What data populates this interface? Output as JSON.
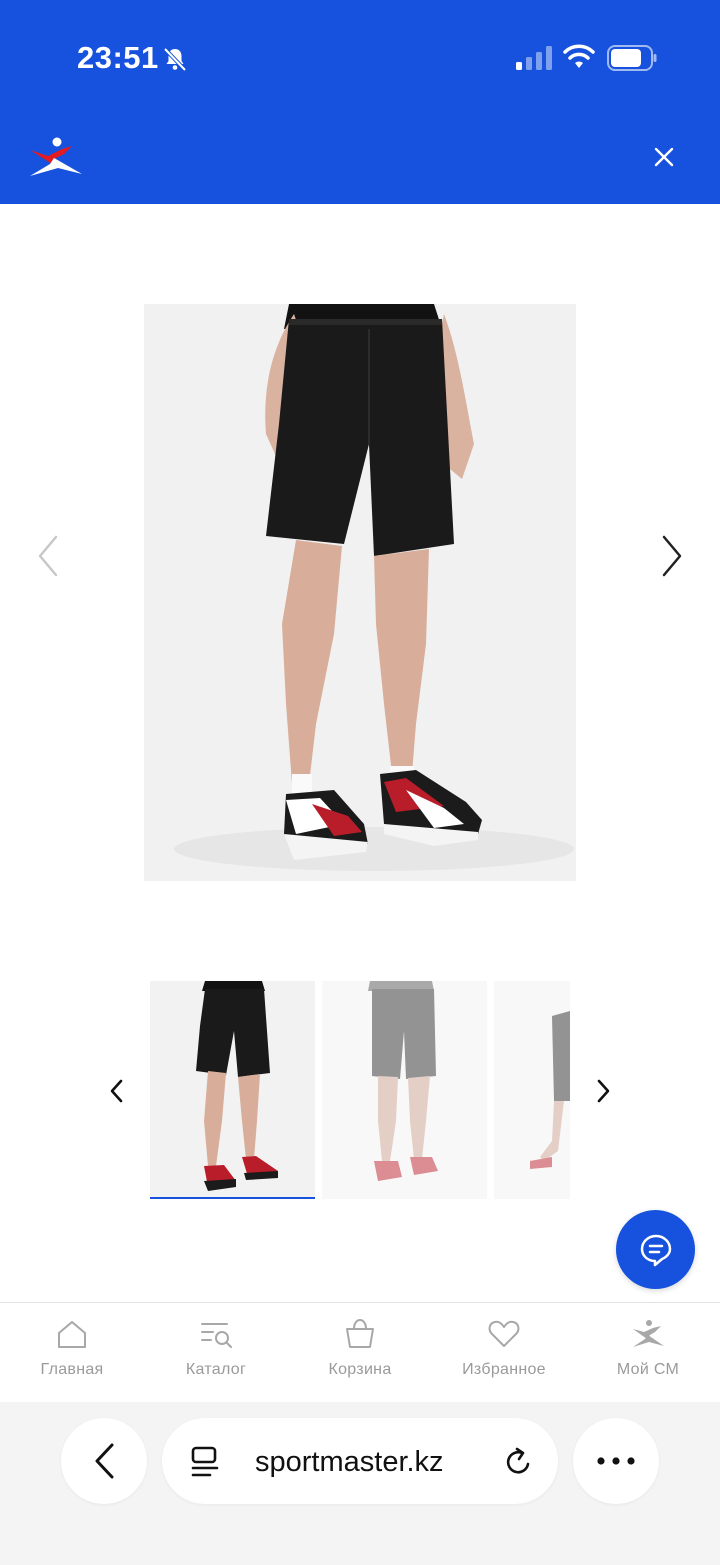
{
  "status_bar": {
    "time": "23:51"
  },
  "header": {
    "brand_color": "#1652dd",
    "logo_icon": "sportmaster-logo-icon",
    "close_icon": "close-icon"
  },
  "product_gallery": {
    "main_image_alt": "",
    "prev_icon": "chevron-left-icon",
    "next_icon": "chevron-right-icon",
    "thumbnail_count_visible": 3,
    "active_thumbnail": 1
  },
  "chat": {
    "icon": "chat-icon"
  },
  "bottom_nav": {
    "items": [
      {
        "label": "Главная",
        "icon": "home-icon"
      },
      {
        "label": "Каталог",
        "icon": "catalog-search-icon"
      },
      {
        "label": "Корзина",
        "icon": "basket-icon"
      },
      {
        "label": "Избранное",
        "icon": "heart-icon"
      },
      {
        "label": "Мой СМ",
        "icon": "sportmaster-person-icon"
      }
    ]
  },
  "browser": {
    "url": "sportmaster.kz"
  }
}
